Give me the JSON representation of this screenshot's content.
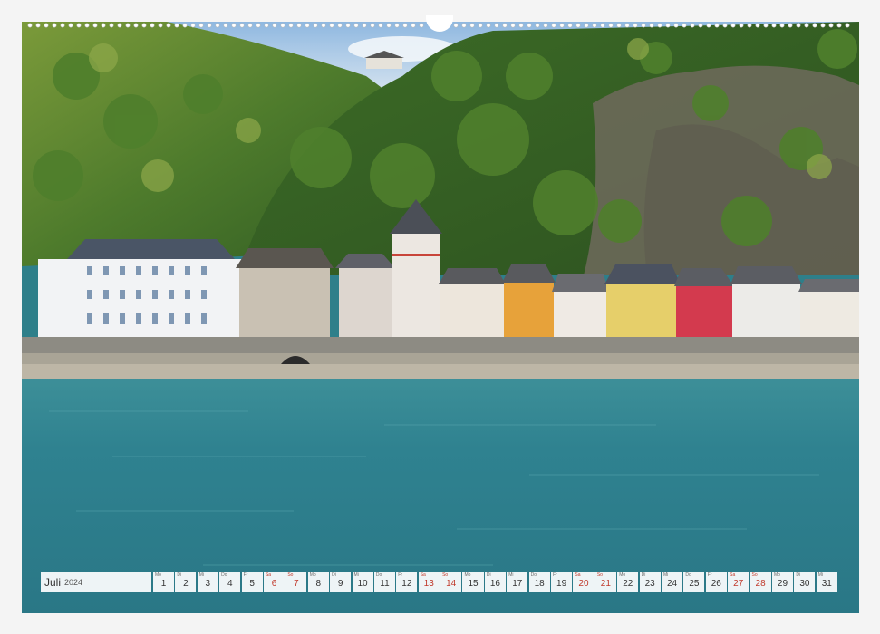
{
  "calendar": {
    "month": "Juli",
    "year": "2024",
    "days": [
      {
        "wd": "Mo",
        "n": "1",
        "we": false
      },
      {
        "wd": "Di",
        "n": "2",
        "we": false
      },
      {
        "wd": "Mi",
        "n": "3",
        "we": false
      },
      {
        "wd": "Do",
        "n": "4",
        "we": false
      },
      {
        "wd": "Fr",
        "n": "5",
        "we": false
      },
      {
        "wd": "Sa",
        "n": "6",
        "we": true
      },
      {
        "wd": "So",
        "n": "7",
        "we": true
      },
      {
        "wd": "Mo",
        "n": "8",
        "we": false
      },
      {
        "wd": "Di",
        "n": "9",
        "we": false
      },
      {
        "wd": "Mi",
        "n": "10",
        "we": false
      },
      {
        "wd": "Do",
        "n": "11",
        "we": false
      },
      {
        "wd": "Fr",
        "n": "12",
        "we": false
      },
      {
        "wd": "Sa",
        "n": "13",
        "we": true
      },
      {
        "wd": "So",
        "n": "14",
        "we": true
      },
      {
        "wd": "Mo",
        "n": "15",
        "we": false
      },
      {
        "wd": "Di",
        "n": "16",
        "we": false
      },
      {
        "wd": "Mi",
        "n": "17",
        "we": false
      },
      {
        "wd": "Do",
        "n": "18",
        "we": false
      },
      {
        "wd": "Fr",
        "n": "19",
        "we": false
      },
      {
        "wd": "Sa",
        "n": "20",
        "we": true
      },
      {
        "wd": "So",
        "n": "21",
        "we": true
      },
      {
        "wd": "Mo",
        "n": "22",
        "we": false
      },
      {
        "wd": "Di",
        "n": "23",
        "we": false
      },
      {
        "wd": "Mi",
        "n": "24",
        "we": false
      },
      {
        "wd": "Do",
        "n": "25",
        "we": false
      },
      {
        "wd": "Fr",
        "n": "26",
        "we": false
      },
      {
        "wd": "Sa",
        "n": "27",
        "we": true
      },
      {
        "wd": "So",
        "n": "28",
        "we": true
      },
      {
        "wd": "Mo",
        "n": "29",
        "we": false
      },
      {
        "wd": "Di",
        "n": "30",
        "we": false
      },
      {
        "wd": "Mi",
        "n": "31",
        "we": false
      }
    ]
  },
  "colors": {
    "weekend": "#c0392b",
    "water": "#2e7f8a",
    "forest": "#3f6e2a"
  }
}
